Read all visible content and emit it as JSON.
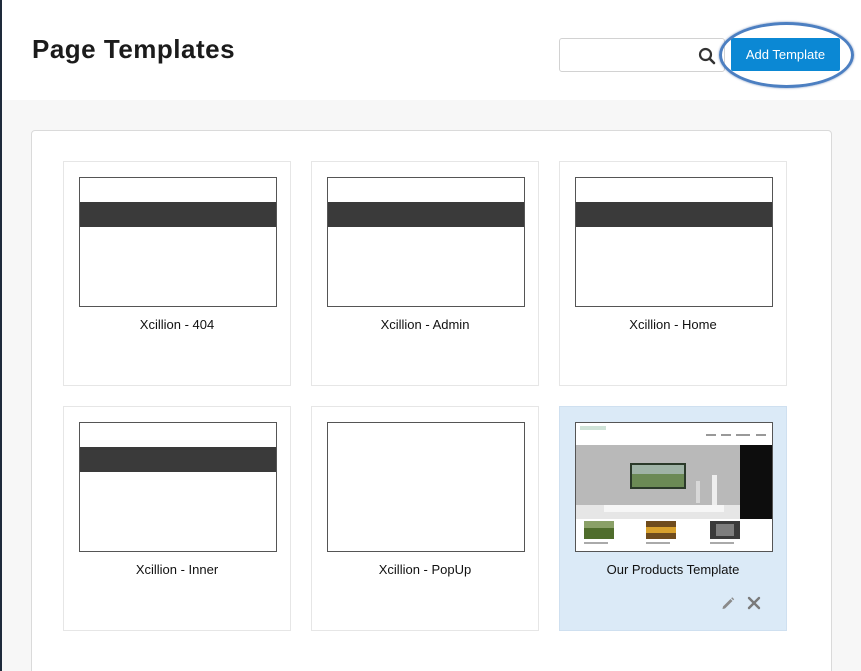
{
  "page": {
    "title": "Page Templates"
  },
  "search": {
    "placeholder": "",
    "value": "",
    "icon": "search-icon"
  },
  "toolbar": {
    "add_label": "Add Template"
  },
  "colors": {
    "accent": "#0b88d4",
    "selected_card": "#dbeaf7",
    "highlight_ring": "#4c7fc1"
  },
  "templates": [
    {
      "name": "Xcillion - 404",
      "thumbnail": "header-band"
    },
    {
      "name": "Xcillion - Admin",
      "thumbnail": "header-band"
    },
    {
      "name": "Xcillion - Home",
      "thumbnail": "header-band"
    },
    {
      "name": "Xcillion - Inner",
      "thumbnail": "header-band"
    },
    {
      "name": "Xcillion - PopUp",
      "thumbnail": "blank"
    },
    {
      "name": "Our Products Template",
      "thumbnail": "website-screenshot",
      "selected": true,
      "actions": [
        "pencil-icon",
        "close-icon"
      ]
    }
  ]
}
